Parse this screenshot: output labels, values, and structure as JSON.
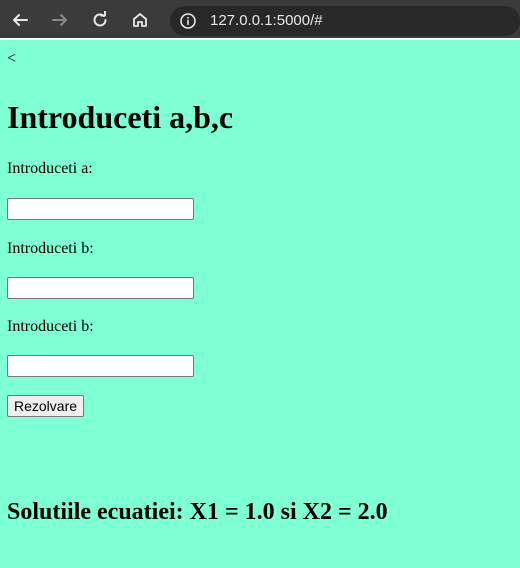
{
  "browser": {
    "url": "127.0.0.1:5000/#",
    "back_icon": "arrow-left-icon",
    "forward_icon": "arrow-right-icon",
    "reload_icon": "reload-icon",
    "home_icon": "home-icon",
    "site_info_icon": "info-icon"
  },
  "page": {
    "back_link": "<",
    "title": "Introduceti a,b,c",
    "fields": [
      {
        "label": "Introduceti a:",
        "value": ""
      },
      {
        "label": "Introduceti b:",
        "value": ""
      },
      {
        "label": "Introduceti b:",
        "value": ""
      }
    ],
    "submit_label": "Rezolvare",
    "result_text": "Solutiile ecuatiei: X1 = 1.0 si X2 = 2.0"
  },
  "colors": {
    "background": "#7fffd4",
    "browser_bar": "#3b3b3b"
  }
}
